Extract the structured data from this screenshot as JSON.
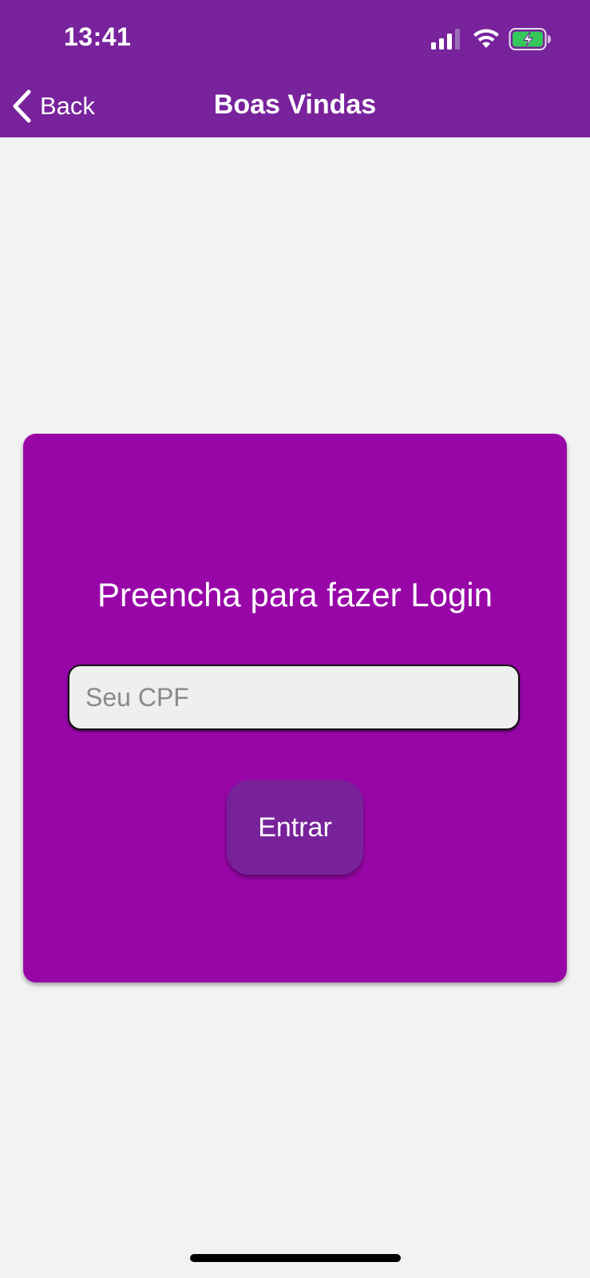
{
  "status_bar": {
    "time": "13:41",
    "icons": [
      "signal-icon",
      "wifi-icon",
      "battery-charging-icon"
    ],
    "battery_color": "#34c759"
  },
  "nav": {
    "back_label": "Back",
    "title": "Boas Vindas",
    "back_icon": "chevron-left-icon"
  },
  "login": {
    "heading": "Preencha para fazer Login",
    "cpf_placeholder": "Seu CPF",
    "cpf_value": "",
    "submit_label": "Entrar"
  },
  "colors": {
    "header_bg": "#78239c",
    "card_bg": "#9806a8",
    "button_bg": "#78229a",
    "page_bg": "#f2f2f2",
    "input_bg": "#efefef"
  }
}
